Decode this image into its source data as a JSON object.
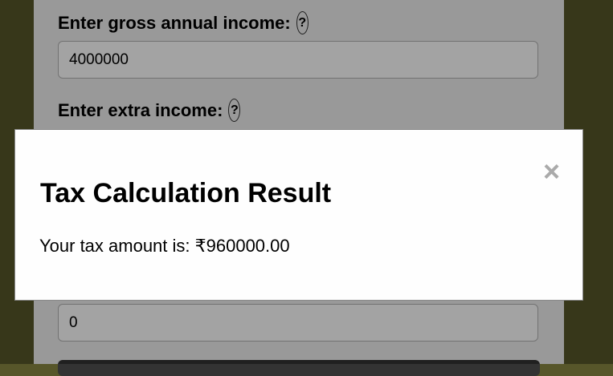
{
  "form": {
    "gross_income": {
      "label": "Enter gross annual income:",
      "help": "?",
      "value": "4000000"
    },
    "extra_income": {
      "label": "Enter extra income:",
      "help": "?"
    },
    "lower_field": {
      "value": "0"
    }
  },
  "modal": {
    "close_glyph": "×",
    "title": "Tax Calculation Result",
    "result_text": "Your tax amount is: ₹960000.00"
  },
  "colors": {
    "page_background": "#57562a",
    "card_background": "#f0f0f0",
    "overlay": "rgba(0,0,0,0.36)",
    "modal_background": "#fefefe",
    "close_icon": "#aaa"
  }
}
